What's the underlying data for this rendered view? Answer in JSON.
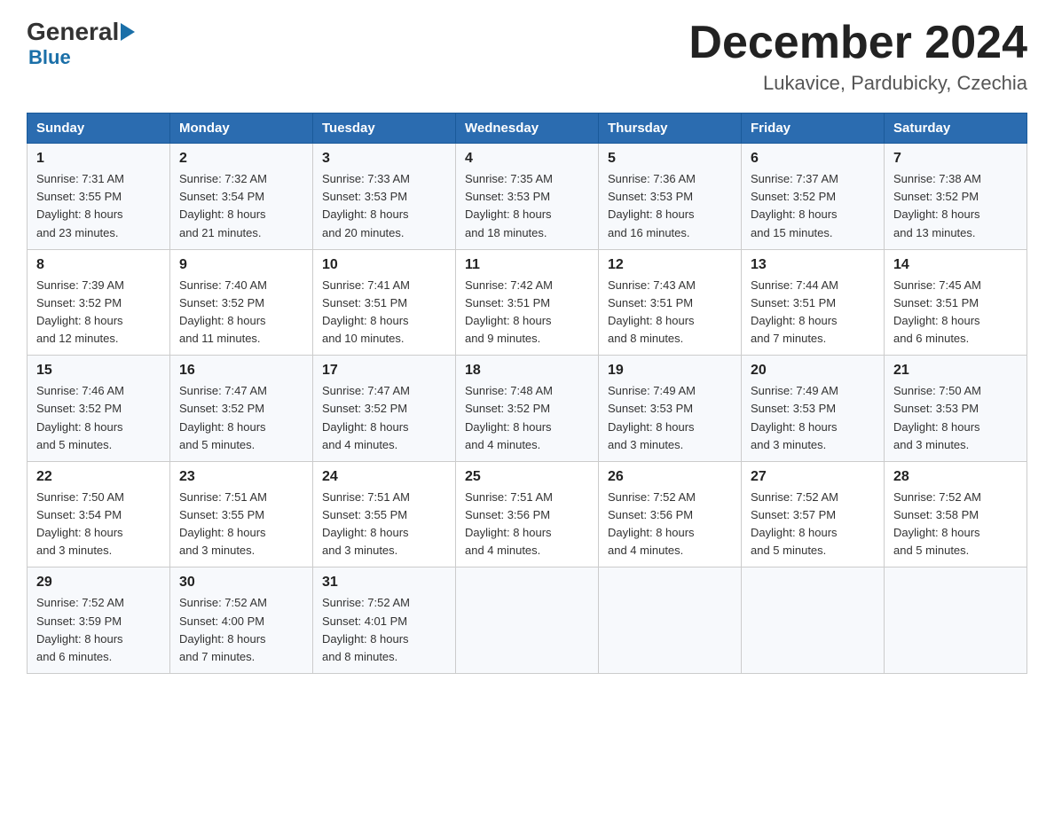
{
  "header": {
    "logo_general": "General",
    "logo_blue": "Blue",
    "month_title": "December 2024",
    "location": "Lukavice, Pardubicky, Czechia"
  },
  "days_of_week": [
    "Sunday",
    "Monday",
    "Tuesday",
    "Wednesday",
    "Thursday",
    "Friday",
    "Saturday"
  ],
  "weeks": [
    [
      {
        "day": "1",
        "sunrise": "7:31 AM",
        "sunset": "3:55 PM",
        "daylight": "8 hours and 23 minutes."
      },
      {
        "day": "2",
        "sunrise": "7:32 AM",
        "sunset": "3:54 PM",
        "daylight": "8 hours and 21 minutes."
      },
      {
        "day": "3",
        "sunrise": "7:33 AM",
        "sunset": "3:53 PM",
        "daylight": "8 hours and 20 minutes."
      },
      {
        "day": "4",
        "sunrise": "7:35 AM",
        "sunset": "3:53 PM",
        "daylight": "8 hours and 18 minutes."
      },
      {
        "day": "5",
        "sunrise": "7:36 AM",
        "sunset": "3:53 PM",
        "daylight": "8 hours and 16 minutes."
      },
      {
        "day": "6",
        "sunrise": "7:37 AM",
        "sunset": "3:52 PM",
        "daylight": "8 hours and 15 minutes."
      },
      {
        "day": "7",
        "sunrise": "7:38 AM",
        "sunset": "3:52 PM",
        "daylight": "8 hours and 13 minutes."
      }
    ],
    [
      {
        "day": "8",
        "sunrise": "7:39 AM",
        "sunset": "3:52 PM",
        "daylight": "8 hours and 12 minutes."
      },
      {
        "day": "9",
        "sunrise": "7:40 AM",
        "sunset": "3:52 PM",
        "daylight": "8 hours and 11 minutes."
      },
      {
        "day": "10",
        "sunrise": "7:41 AM",
        "sunset": "3:51 PM",
        "daylight": "8 hours and 10 minutes."
      },
      {
        "day": "11",
        "sunrise": "7:42 AM",
        "sunset": "3:51 PM",
        "daylight": "8 hours and 9 minutes."
      },
      {
        "day": "12",
        "sunrise": "7:43 AM",
        "sunset": "3:51 PM",
        "daylight": "8 hours and 8 minutes."
      },
      {
        "day": "13",
        "sunrise": "7:44 AM",
        "sunset": "3:51 PM",
        "daylight": "8 hours and 7 minutes."
      },
      {
        "day": "14",
        "sunrise": "7:45 AM",
        "sunset": "3:51 PM",
        "daylight": "8 hours and 6 minutes."
      }
    ],
    [
      {
        "day": "15",
        "sunrise": "7:46 AM",
        "sunset": "3:52 PM",
        "daylight": "8 hours and 5 minutes."
      },
      {
        "day": "16",
        "sunrise": "7:47 AM",
        "sunset": "3:52 PM",
        "daylight": "8 hours and 5 minutes."
      },
      {
        "day": "17",
        "sunrise": "7:47 AM",
        "sunset": "3:52 PM",
        "daylight": "8 hours and 4 minutes."
      },
      {
        "day": "18",
        "sunrise": "7:48 AM",
        "sunset": "3:52 PM",
        "daylight": "8 hours and 4 minutes."
      },
      {
        "day": "19",
        "sunrise": "7:49 AM",
        "sunset": "3:53 PM",
        "daylight": "8 hours and 3 minutes."
      },
      {
        "day": "20",
        "sunrise": "7:49 AM",
        "sunset": "3:53 PM",
        "daylight": "8 hours and 3 minutes."
      },
      {
        "day": "21",
        "sunrise": "7:50 AM",
        "sunset": "3:53 PM",
        "daylight": "8 hours and 3 minutes."
      }
    ],
    [
      {
        "day": "22",
        "sunrise": "7:50 AM",
        "sunset": "3:54 PM",
        "daylight": "8 hours and 3 minutes."
      },
      {
        "day": "23",
        "sunrise": "7:51 AM",
        "sunset": "3:55 PM",
        "daylight": "8 hours and 3 minutes."
      },
      {
        "day": "24",
        "sunrise": "7:51 AM",
        "sunset": "3:55 PM",
        "daylight": "8 hours and 3 minutes."
      },
      {
        "day": "25",
        "sunrise": "7:51 AM",
        "sunset": "3:56 PM",
        "daylight": "8 hours and 4 minutes."
      },
      {
        "day": "26",
        "sunrise": "7:52 AM",
        "sunset": "3:56 PM",
        "daylight": "8 hours and 4 minutes."
      },
      {
        "day": "27",
        "sunrise": "7:52 AM",
        "sunset": "3:57 PM",
        "daylight": "8 hours and 5 minutes."
      },
      {
        "day": "28",
        "sunrise": "7:52 AM",
        "sunset": "3:58 PM",
        "daylight": "8 hours and 5 minutes."
      }
    ],
    [
      {
        "day": "29",
        "sunrise": "7:52 AM",
        "sunset": "3:59 PM",
        "daylight": "8 hours and 6 minutes."
      },
      {
        "day": "30",
        "sunrise": "7:52 AM",
        "sunset": "4:00 PM",
        "daylight": "8 hours and 7 minutes."
      },
      {
        "day": "31",
        "sunrise": "7:52 AM",
        "sunset": "4:01 PM",
        "daylight": "8 hours and 8 minutes."
      },
      null,
      null,
      null,
      null
    ]
  ],
  "labels": {
    "sunrise_prefix": "Sunrise: ",
    "sunset_prefix": "Sunset: ",
    "daylight_prefix": "Daylight: "
  }
}
